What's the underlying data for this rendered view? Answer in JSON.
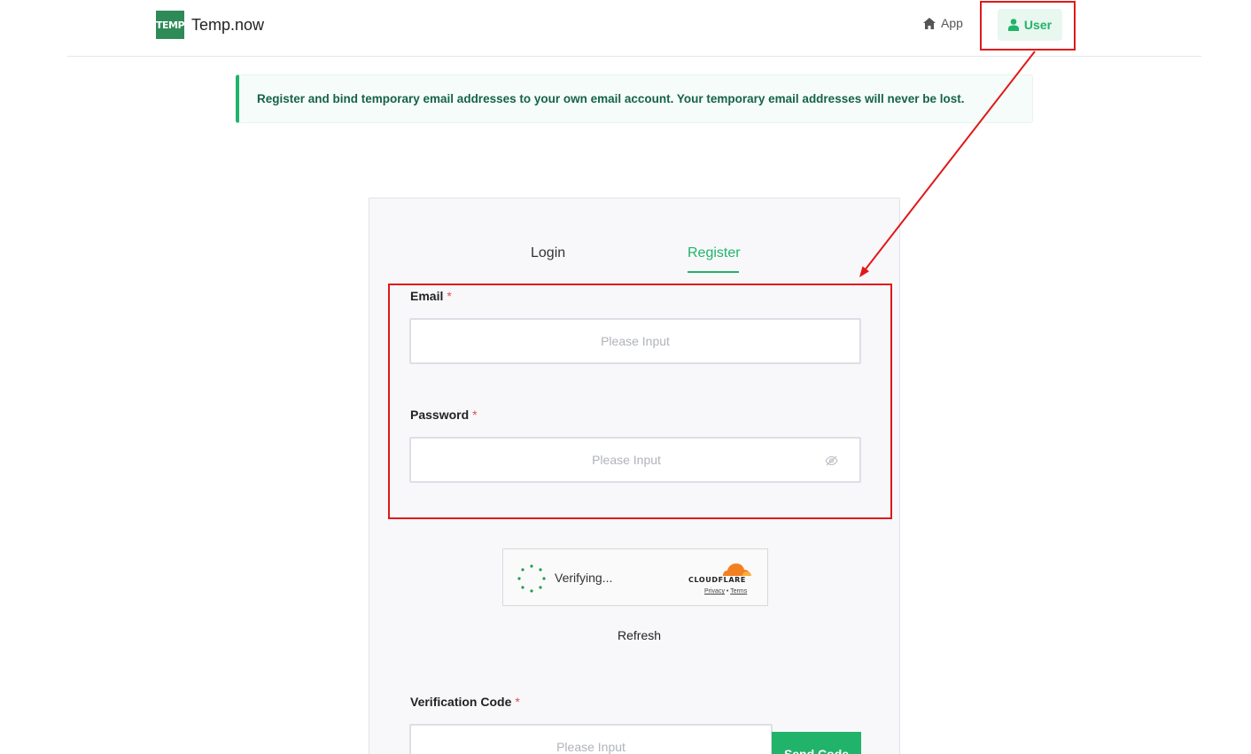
{
  "header": {
    "logo_badge": "TEMP",
    "site_name": "Temp.now",
    "nav_app": "App",
    "nav_user": "User"
  },
  "banner": {
    "text": "Register and bind temporary email addresses to your own email account. Your temporary email addresses will never be lost."
  },
  "tabs": {
    "login": "Login",
    "register": "Register",
    "active": "Register"
  },
  "form": {
    "email_label": "Email",
    "password_label": "Password",
    "verification_label": "Verification Code",
    "required_mark": "*",
    "email_placeholder": "Please Input",
    "password_placeholder": "Please Input",
    "code_placeholder": "Please Input",
    "refresh_label": "Refresh",
    "send_code_label": "Send Code"
  },
  "captcha": {
    "status": "Verifying...",
    "brand": "CLOUDFLARE",
    "privacy": "Privacy",
    "separator": "•",
    "terms": "Terms"
  },
  "colors": {
    "accent": "#21b36a",
    "logo": "#2e8b57",
    "annotation": "#e01919",
    "cloudflare_orange": "#f38020"
  },
  "icons": [
    "home-icon",
    "user-icon",
    "eye-off-icon",
    "spinner-icon",
    "cloudflare-logo-icon"
  ]
}
